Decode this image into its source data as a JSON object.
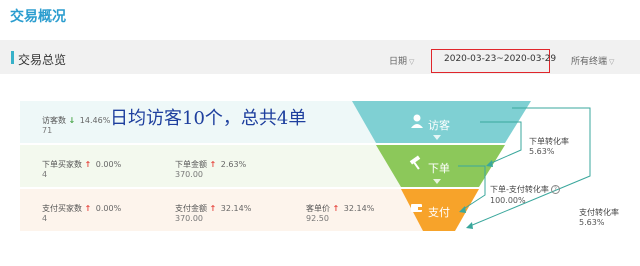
{
  "header": {
    "title": "交易概况"
  },
  "section": {
    "title": "交易总览",
    "date_label": "日期",
    "date_range": "2020-03-23~2020-03-29",
    "terminal_label": "所有终端"
  },
  "overlay_text": "日均访客10个，总共4单",
  "rows": [
    {
      "metrics": [
        {
          "label": "访客数",
          "trend": "down",
          "pct": "14.46%",
          "value": "71"
        }
      ]
    },
    {
      "metrics": [
        {
          "label": "下单买家数",
          "trend": "up",
          "pct": "0.00%",
          "value": "4"
        },
        {
          "label": "下单金额",
          "trend": "up",
          "pct": "2.63%",
          "value": "370.00"
        }
      ]
    },
    {
      "metrics": [
        {
          "label": "支付买家数",
          "trend": "up",
          "pct": "0.00%",
          "value": "4"
        },
        {
          "label": "支付金额",
          "trend": "up",
          "pct": "32.14%",
          "value": "370.00"
        },
        {
          "label": "客单价",
          "trend": "up",
          "pct": "32.14%",
          "value": "92.50"
        }
      ]
    }
  ],
  "funnel": {
    "stages": [
      {
        "label": "访客",
        "icon": "user-icon",
        "color": "#7fd0d3"
      },
      {
        "label": "下单",
        "icon": "hammer-icon",
        "color": "#8cc85a"
      },
      {
        "label": "支付",
        "icon": "wallet-icon",
        "color": "#f7a32a"
      }
    ],
    "rates": [
      {
        "title": "下单转化率",
        "value": "5.63%"
      },
      {
        "title": "下单-支付转化率",
        "value": "100.00%",
        "help_icon": "?"
      },
      {
        "title": "支付转化率",
        "value": "5.63%"
      }
    ]
  },
  "colors": {
    "title_blue": "#2b9dcf",
    "accent": "#37b1c9",
    "highlight_border": "#e0262b",
    "overlay_text": "#1e3f9e",
    "up": "#e74b43",
    "down": "#48a548"
  }
}
